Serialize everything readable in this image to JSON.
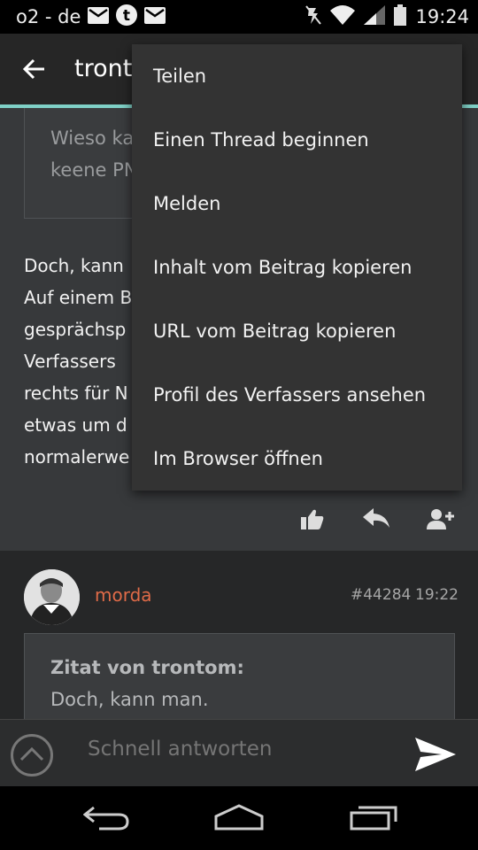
{
  "status_bar": {
    "carrier": "o2 - de",
    "time": "19:24",
    "icons": [
      "mail-icon",
      "tumblr-icon",
      "mail-icon",
      "mute-icon",
      "wifi-icon",
      "signal-icon",
      "battery-icon"
    ]
  },
  "app_bar": {
    "title": "trontom"
  },
  "post1": {
    "quote_lines": [
      "Wieso ka",
      "keene PN"
    ],
    "body_lines": [
      "Doch, kann",
      "Auf einem B",
      "gesprächsp",
      "Verfassers",
      "rechts für N",
      "etwas um d",
      "normalerwe"
    ]
  },
  "post2": {
    "author": "morda",
    "post_id": "#44284",
    "time": "19:22",
    "quote_header": "Zitat von trontom:",
    "quote_text": "Doch, kann man."
  },
  "reply": {
    "placeholder": "Schnell antworten"
  },
  "menu": {
    "items": [
      "Teilen",
      "Einen Thread beginnen",
      "Melden",
      "Inhalt vom Beitrag kopieren",
      "URL vom Beitrag kopieren",
      "Profil des Verfassers ansehen",
      "Im Browser öffnen"
    ]
  },
  "colors": {
    "accent": "#7fd0c6",
    "author": "#e06b48",
    "menu_bg": "#333333"
  }
}
